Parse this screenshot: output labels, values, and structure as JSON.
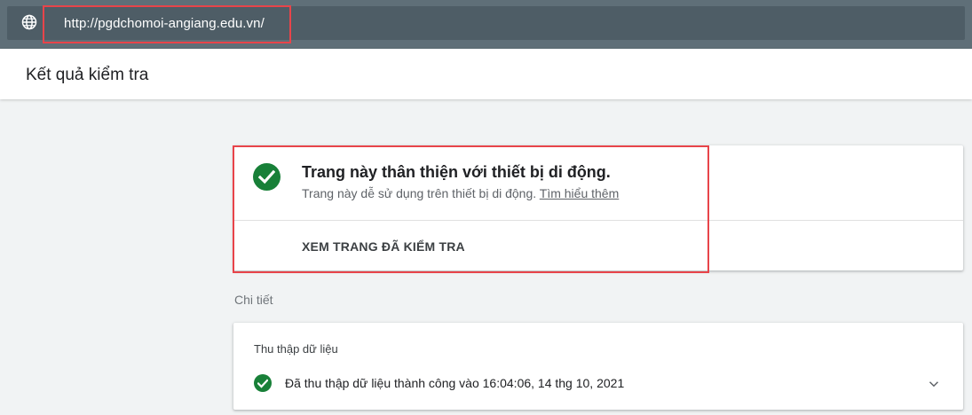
{
  "address_bar": {
    "url": "http://pgdchomoi-angiang.edu.vn/",
    "icon": "globe-icon"
  },
  "header": {
    "title": "Kết quả kiểm tra"
  },
  "result": {
    "icon": "check-circle-icon",
    "headline": "Trang này thân thiện với thiết bị di động.",
    "subtext": "Trang này dễ sử dụng trên thiết bị di động.",
    "learn_more": "Tìm hiểu thêm",
    "view_tested_page": "XEM TRANG ĐÃ KIỂM TRA"
  },
  "details": {
    "label": "Chi tiết",
    "section_title": "Thu thập dữ liệu",
    "status_icon": "check-circle-icon",
    "status_text": "Đã thu thập dữ liệu thành công vào 16:04:06, 14 thg 10, 2021",
    "expand_icon": "chevron-down-icon"
  },
  "colors": {
    "topbar": "#5f6f78",
    "success_green": "#188038",
    "highlight_red": "#e8444a",
    "page_background": "#f1f3f4"
  }
}
